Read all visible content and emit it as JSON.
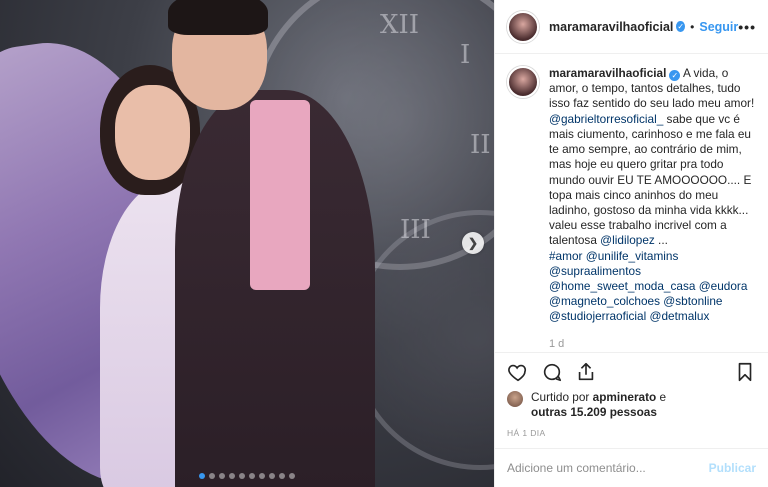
{
  "post": {
    "username": "maramaravilhaoficial",
    "follow_label": "Seguir",
    "separator": "•",
    "more_label": "•••",
    "verified_mark": "✓"
  },
  "photo": {
    "nav_next": "❯",
    "carousel_dots": 10,
    "active_dot": 0,
    "clock_numerals": [
      "XII",
      "I",
      "II",
      "III"
    ]
  },
  "caption": {
    "username": "maramaravilhaoficial",
    "text_1": " A vida, o amor, o tempo, tantos detalhes, tudo isso faz sentido do seu lado meu amor! ",
    "mention_1": "@gabrieltorresoficial_",
    "text_2": " sabe que vc é mais ciumento, carinhoso e me fala eu te amo sempre, ao contrário de mim, mas hoje eu quero gritar pra todo mundo ouvir EU TE AMOOOOOO.... E topa mais cinco aninhos do meu ladinho, gostoso da minha vida kkkk... valeu esse trabalho incrivel com a talentosa ",
    "mention_2": "@lidilopez",
    "text_3": " ...",
    "tags": [
      "#amor",
      "@unilife_vitamins",
      "@supraalimentos",
      "@home_sweet_moda_casa",
      "@eudora",
      "@magneto_colchoes",
      "@sbtonline",
      "@studiojerraoficial",
      "@detmalux"
    ],
    "time": "1 d"
  },
  "actions": {
    "like_icon": "heart-icon",
    "comment_icon": "comment-icon",
    "share_icon": "share-icon",
    "save_icon": "bookmark-icon"
  },
  "likes": {
    "prefix": "Curtido por ",
    "user": "apminerato",
    "middle": " e ",
    "others": "outras 15.209 pessoas"
  },
  "posted_ago": "HÁ 1 DIA",
  "comment_box": {
    "placeholder": "Adicione um comentário...",
    "publish_label": "Publicar"
  },
  "colors": {
    "accent": "#3897f0",
    "tag": "#003569",
    "publish_disabled": "#b2dffc"
  }
}
